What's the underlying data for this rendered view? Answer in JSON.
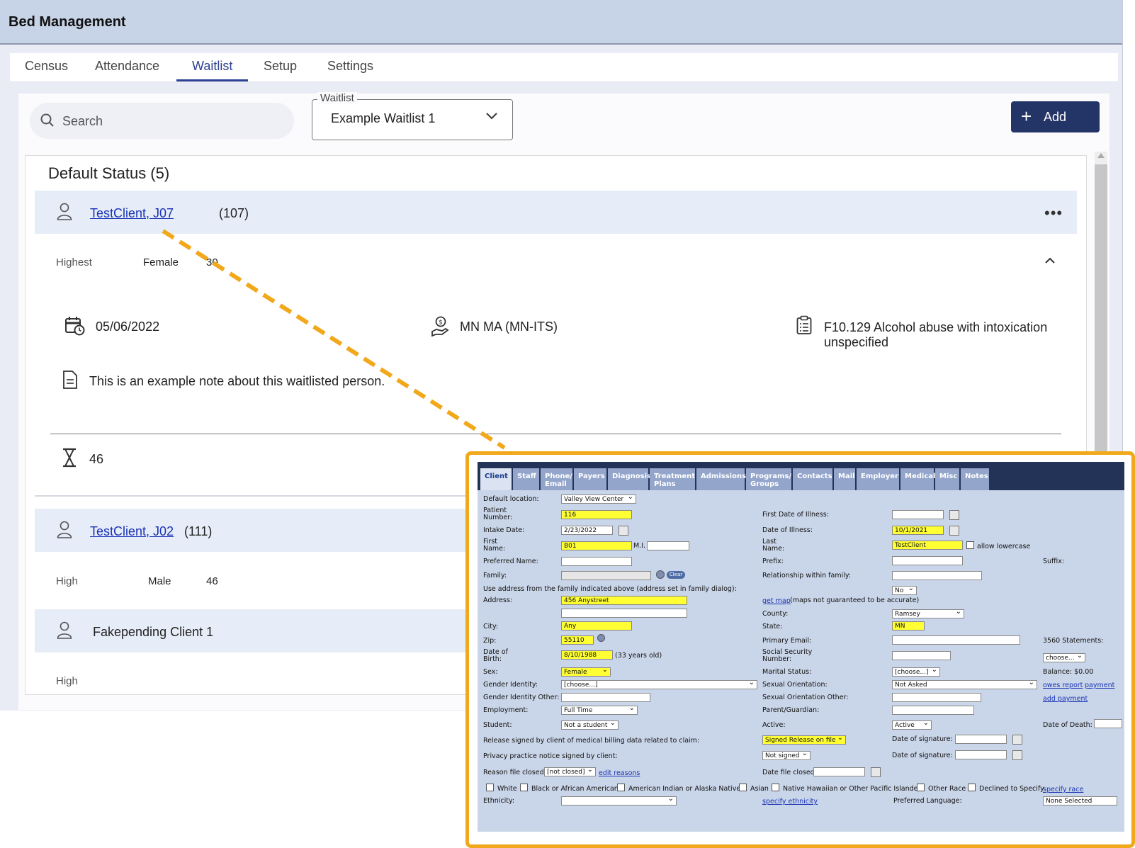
{
  "app": {
    "title": "Bed Management"
  },
  "tabs": [
    {
      "label": "Census"
    },
    {
      "label": "Attendance"
    },
    {
      "label": "Waitlist"
    },
    {
      "label": "Setup"
    },
    {
      "label": "Settings"
    }
  ],
  "toolbar": {
    "search_placeholder": "Search",
    "waitlist_label": "Waitlist",
    "waitlist_value": "Example Waitlist 1",
    "add_label": "Add"
  },
  "list": {
    "section_title": "Default Status (5)",
    "entries": [
      {
        "name": "TestClient, J07",
        "number": "(107)",
        "priority": "Highest",
        "sex": "Female",
        "age": "30",
        "date": "05/06/2022",
        "payer": "MN MA (MN-ITS)",
        "diagnosis_line1": "F10.129 Alcohol abuse with intoxication",
        "diagnosis_line2": "unspecified",
        "note": "This is an example note about this waitlisted person.",
        "days_waiting": "46"
      },
      {
        "name": "TestClient, J02",
        "number": "(111)",
        "priority": "High",
        "sex": "Male",
        "age": "46"
      },
      {
        "name": "Fakepending Client 1",
        "priority": "High"
      }
    ]
  },
  "overlay": {
    "tabs": [
      "Client",
      "Staff",
      "Phone/\nEmail",
      "Payers",
      "Diagnosis",
      "Treatment\nPlans",
      "Admissions",
      "Programs/\nGroups",
      "Contacts",
      "Mail",
      "Employer",
      "Medical",
      "Misc",
      "Notes"
    ],
    "labels": {
      "default_location": "Default location:",
      "patient_number": "Patient\nNumber:",
      "intake_date": "Intake Date:",
      "first_name": "First\nName:",
      "mi": "M.I.",
      "preferred_name": "Preferred Name:",
      "family": "Family:",
      "clear": "Clear",
      "use_address": "Use address from the family indicated above (address set in family dialog):",
      "address": "Address:",
      "city": "City:",
      "zip": "Zip:",
      "dob": "Date of\nBirth:",
      "age_note": "(33 years old)",
      "sex": "Sex:",
      "gender_identity": "Gender Identity:",
      "gender_identity_other": "Gender Identity Other:",
      "employment": "Employment:",
      "student": "Student:",
      "release_signed": "Release signed by client of medical billing data related to claim:",
      "privacy_notice": "Privacy practice notice signed by client:",
      "reason_closed": "Reason file closed:",
      "edit_reasons": "edit reasons",
      "ethnicity": "Ethnicity:",
      "first_date_illness": "First Date of Illness:",
      "date_illness": "Date of Illness:",
      "last_name": "Last\nName:",
      "allow_lowercase": "allow lowercase",
      "prefix": "Prefix:",
      "suffix": "Suffix:",
      "relationship": "Relationship within family:",
      "get_map": "get map",
      "map_note": "(maps not guaranteed to be accurate)",
      "county": "County:",
      "state": "State:",
      "primary_email": "Primary Email:",
      "statements": "3560 Statements:",
      "ssn": "Social Security\nNumber:",
      "marital": "Marital Status:",
      "balance": "Balance: $0.00",
      "sexual_orientation": "Sexual Orientation:",
      "owes_report": "owes report",
      "payment": "payment",
      "sexual_orientation_other": "Sexual Orientation Other:",
      "add_payment": "add payment",
      "parent": "Parent/Guardian:",
      "active": "Active:",
      "date_of_death": "Date of Death:",
      "date_signature": "Date of signature:",
      "date_file_closed": "Date file closed:",
      "specify_race": "specify race",
      "specify_ethnicity": "specify ethnicity",
      "preferred_language": "Preferred Language:"
    },
    "values": {
      "default_location": "Valley View Center",
      "patient_number": "116",
      "intake_date": "2/23/2022",
      "first_name": "B01",
      "address": "456 Anystreet",
      "city": "Any",
      "zip": "55110",
      "dob": "8/10/1988",
      "sex": "Female",
      "gender_identity": "[choose...]",
      "employment": "Full Time",
      "student": "Not a student",
      "release": "Signed Release on file",
      "privacy": "Not signed",
      "reason_closed": "[not closed]",
      "date_illness": "10/1/2021",
      "last_name": "TestClient",
      "use_address": "No",
      "county": "Ramsey",
      "state": "MN",
      "statements": "choose...",
      "marital": "[choose...]",
      "sexual_orientation": "Not Asked",
      "active": "Active",
      "preferred_language": "None Selected"
    },
    "race": [
      "White",
      "Black or African American",
      "American Indian or Alaska Native",
      "Asian",
      "Native Hawaiian or Other Pacific Islander",
      "Other Race",
      "Declined to Specify"
    ]
  },
  "colors": {
    "accent": "#2c4193",
    "add_button": "#233466",
    "highlight": "#f1a81a",
    "link": "#1a33b5"
  }
}
